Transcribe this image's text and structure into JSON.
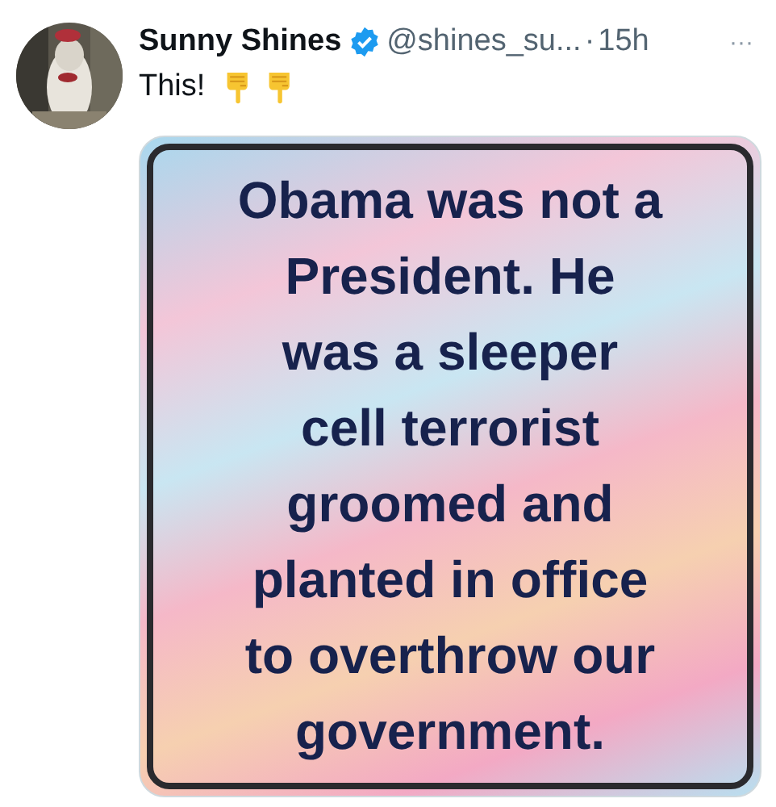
{
  "post": {
    "author_name": "Sunny Shines",
    "verified": true,
    "handle": "@shines_su...",
    "separator": "·",
    "time": "15h",
    "more": "···",
    "text": "This!",
    "media": {
      "kind": "picture",
      "text_lines": [
        "Obama was not a",
        "President. He",
        "was a sleeper",
        "cell terrorist",
        "groomed and",
        "planted in office",
        "to overthrow our",
        "government."
      ]
    }
  }
}
